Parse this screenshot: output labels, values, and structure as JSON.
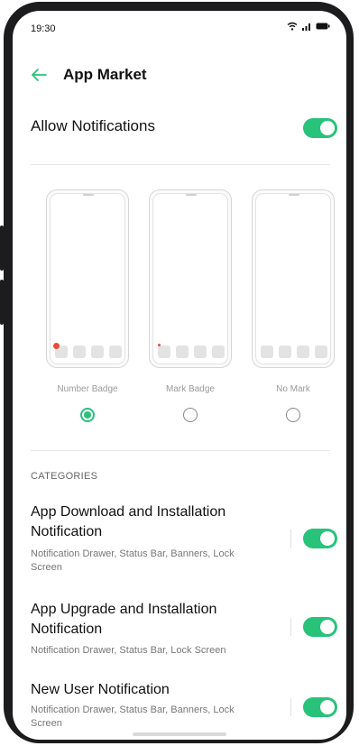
{
  "status_bar": {
    "time": "19:30",
    "icons": [
      "wifi-icon",
      "signal-icon",
      "battery-icon"
    ]
  },
  "header": {
    "title": "App Market",
    "back_icon": "arrow-left-icon"
  },
  "allow_notifications": {
    "label": "Allow Notifications",
    "enabled": true
  },
  "badge_styles": [
    {
      "label": "Number Badge",
      "selected": true
    },
    {
      "label": "Mark Badge",
      "selected": false
    },
    {
      "label": "No Mark",
      "selected": false
    }
  ],
  "categories": {
    "heading": "CATEGORIES",
    "items": [
      {
        "title": "App Download and Installation Notification",
        "description": "Notification Drawer, Status Bar, Banners, Lock Screen",
        "enabled": true
      },
      {
        "title": "App Upgrade and Installation Notification",
        "description": "Notification Drawer, Status Bar, Lock Screen",
        "enabled": true
      },
      {
        "title": "New User Notification",
        "description": "Notification Drawer, Status Bar, Banners, Lock Screen",
        "enabled": true
      }
    ]
  },
  "colors": {
    "accent": "#29c27a",
    "badge": "#e84c3d"
  }
}
